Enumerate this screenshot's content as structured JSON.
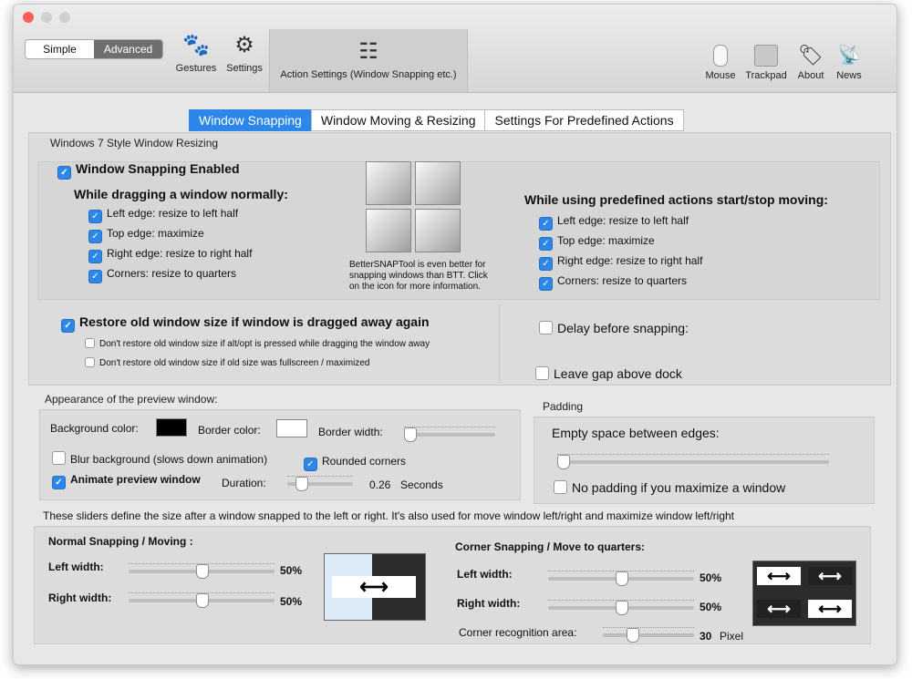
{
  "toolbar": {
    "simple_label": "Simple",
    "advanced_label": "Advanced",
    "gestures_label": "Gestures",
    "settings_label": "Settings",
    "action_settings_label": "Action Settings (Window Snapping etc.)",
    "mouse_label": "Mouse",
    "trackpad_label": "Trackpad",
    "about_label": "About",
    "news_label": "News"
  },
  "tabs": [
    "Window Snapping",
    "Window Moving & Resizing",
    "Settings For Predefined Actions"
  ],
  "win7": {
    "title": "Windows 7 Style Window Resizing",
    "enabled_label": "Window Snapping Enabled",
    "dragging_heading": "While dragging a window normally:",
    "drag_options": [
      "Left edge: resize to left half",
      "Top edge: maximize",
      "Right edge: resize to right half",
      "Corners: resize to quarters"
    ],
    "predefined_heading": "While using predefined actions start/stop moving:",
    "predefined_options": [
      "Left edge: resize to left half",
      "Top edge: maximize",
      "Right edge: resize to right half",
      "Corners: resize to quarters"
    ],
    "promo_text": "BetterSNAPTool is even better for snapping windows than BTT. Click on the icon for more information.",
    "restore_label": "Restore old window size if window is dragged away again",
    "restore_sub1": "Don't restore old window size if alt/opt is pressed while dragging the window away",
    "restore_sub2": "Don't restore old window size if old size was fullscreen / maximized",
    "delay_label": "Delay before snapping:",
    "gap_label": "Leave gap above dock"
  },
  "preview": {
    "title": "Appearance of the preview window:",
    "bg_color_label": "Background color:",
    "border_color_label": "Border color:",
    "border_width_label": "Border width:",
    "blur_label": "Blur background (slows down animation)",
    "rounded_label": "Rounded corners",
    "animate_label": "Animate preview window",
    "duration_label": "Duration:",
    "duration_value": "0.26",
    "duration_unit": "Seconds",
    "bg_color": "#000000",
    "border_color": "#ffffff",
    "border_width_level": 0.0,
    "duration_level": 0.15
  },
  "padding": {
    "title": "Padding",
    "empty_space_label": "Empty space between edges:",
    "no_padding_label": "No padding if you maximize a window",
    "level": 0.0
  },
  "sizes": {
    "description": "These sliders define the size after a window snapped to the left or right. It's also used for move window left/right and maximize window left/right",
    "normal_heading": "Normal Snapping / Moving :",
    "left_width_label": "Left width:",
    "left_width_value": "50%",
    "right_width_label": "Right width:",
    "right_width_value": "50%",
    "corner_heading": "Corner Snapping / Move to quarters:",
    "corner_left_label": "Left width:",
    "corner_left_value": "50%",
    "corner_right_label": "Right width:",
    "corner_right_value": "50%",
    "recognition_label": "Corner recognition area:",
    "recognition_value": "30",
    "recognition_unit": "Pixel"
  },
  "colors": {
    "accent": "#2d87e8"
  }
}
